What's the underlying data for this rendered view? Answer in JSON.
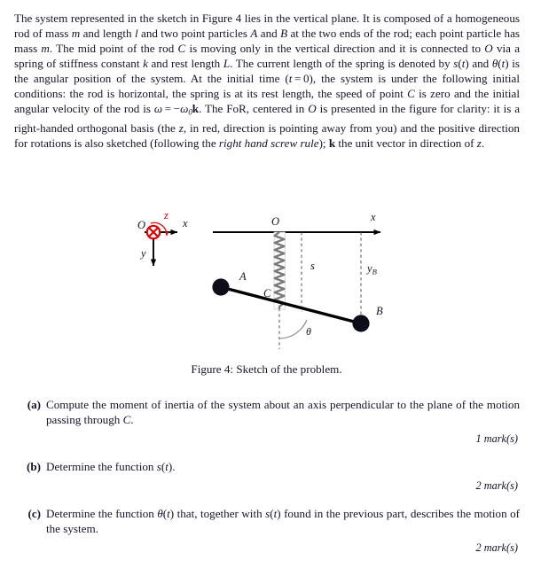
{
  "document": {
    "type": "physics-problem-sheet",
    "intro": {
      "segments": [
        {
          "t": "The system represented in the sketch in Figure 4 lies in the vertical plane. It is composed of a homogeneous rod of mass ",
          "s": "plain"
        },
        {
          "t": "m",
          "s": "math"
        },
        {
          "t": " and length ",
          "s": "plain"
        },
        {
          "t": "l",
          "s": "math"
        },
        {
          "t": " and two point particles ",
          "s": "plain"
        },
        {
          "t": "A",
          "s": "math"
        },
        {
          "t": " and ",
          "s": "plain"
        },
        {
          "t": "B",
          "s": "math"
        },
        {
          "t": " at the two ends of the rod; each point particle has mass ",
          "s": "plain"
        },
        {
          "t": "m",
          "s": "math"
        },
        {
          "t": ". The mid point of the rod ",
          "s": "plain"
        },
        {
          "t": "C",
          "s": "math"
        },
        {
          "t": " is moving only in the vertical direction and it is connected to ",
          "s": "plain"
        },
        {
          "t": "O",
          "s": "math"
        },
        {
          "t": " via a spring of stiffness constant ",
          "s": "plain"
        },
        {
          "t": "k",
          "s": "math"
        },
        {
          "t": " and rest length ",
          "s": "plain"
        },
        {
          "t": "L",
          "s": "math"
        },
        {
          "t": ". The current length of the spring is denoted by ",
          "s": "plain"
        },
        {
          "t": "s(t)",
          "s": "math"
        },
        {
          "t": " and ",
          "s": "plain"
        },
        {
          "t": "θ(t)",
          "s": "math"
        },
        {
          "t": " is the angular position of the system. At the initial time (",
          "s": "plain"
        },
        {
          "t": "t = 0",
          "s": "math"
        },
        {
          "t": "), the system is under the following initial conditions: the rod is horizontal, the spring is at its rest length, the speed of point ",
          "s": "plain"
        },
        {
          "t": "C",
          "s": "math"
        },
        {
          "t": " is zero and the initial angular velocity of the rod is ",
          "s": "plain"
        },
        {
          "t": "ω = −ω₀k",
          "s": "math-bold-k"
        },
        {
          "t": ". The FoR, centered in ",
          "s": "plain"
        },
        {
          "t": "O",
          "s": "math"
        },
        {
          "t": " is presented in the figure for clarity: it is a right-handed orthogonal basis (the ",
          "s": "plain"
        },
        {
          "t": "z",
          "s": "math"
        },
        {
          "t": ", in red, direction is pointing away from you) and the positive direction for rotations is also sketched (following the ",
          "s": "plain"
        },
        {
          "t": "right hand screw rule",
          "s": "italic"
        },
        {
          "t": "); ",
          "s": "plain"
        },
        {
          "t": "k",
          "s": "bold"
        },
        {
          "t": " the unit vector in direction of ",
          "s": "plain"
        },
        {
          "t": "z",
          "s": "math"
        },
        {
          "t": ".",
          "s": "plain"
        }
      ]
    },
    "figure": {
      "caption": "Figure 4: Sketch of the problem.",
      "labels": {
        "origin_left": "O",
        "axis_z": "z",
        "axis_x_left": "x",
        "axis_y_left": "y",
        "origin_main": "O",
        "axis_x_main": "x",
        "spring_length": "s",
        "particle_a": "A",
        "particle_b": "B",
        "midpoint_c": "C",
        "y_of_b": "y",
        "y_of_b_sub": "B",
        "angle_theta": "θ"
      },
      "colors": {
        "z_marker": "#e00000",
        "rod": "#000000",
        "particle": "#0d0d1a",
        "dashed_guide": "#555555",
        "spring": "#6e6e6e"
      }
    },
    "questions": [
      {
        "label": "(a)",
        "text": "Compute the moment of inertia of the system about an axis perpendicular to the plane of the motion passing through C.",
        "marks": "1 mark(s)"
      },
      {
        "label": "(b)",
        "text": "Determine the function s(t).",
        "marks": "2 mark(s)"
      },
      {
        "label": "(c)",
        "text": "Determine the function θ(t) that, together with s(t) found in the previous part, describes the motion of the system.",
        "marks": "2 mark(s)"
      }
    ]
  }
}
